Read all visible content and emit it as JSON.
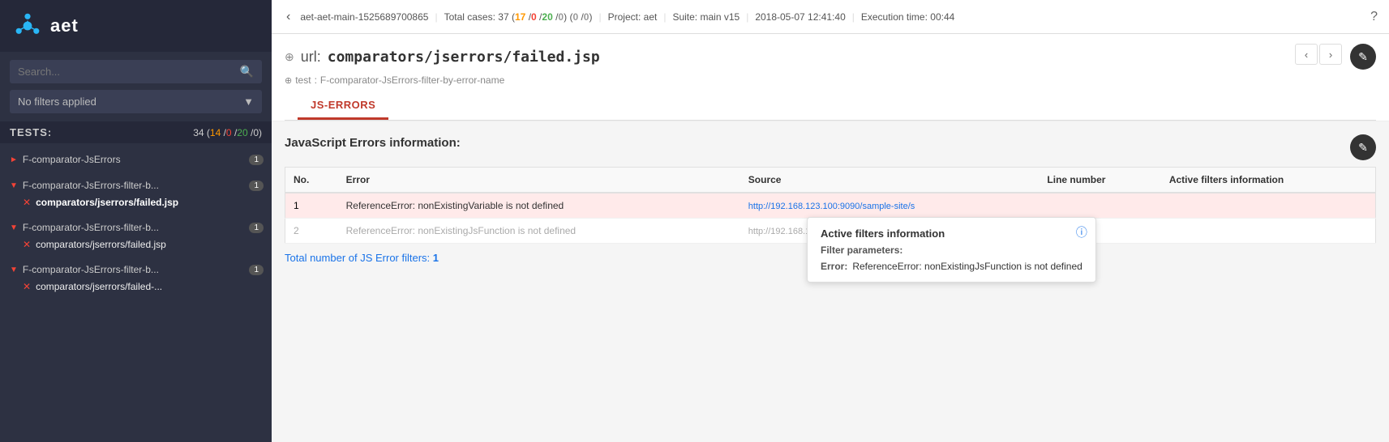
{
  "sidebar": {
    "logo_text": "aet",
    "search_placeholder": "Search...",
    "filter_label": "No filters applied",
    "tests_label": "TESTS:",
    "tests_count": "34",
    "counts": {
      "pass": "14",
      "fail": "0",
      "warn": "20",
      "other": "0"
    },
    "groups": [
      {
        "id": "g1",
        "name": "F-comparator-JsErrors",
        "badge": "1",
        "expanded": false,
        "arrow": "▶",
        "items": []
      },
      {
        "id": "g2",
        "name": "F-comparator-JsErrors-filter-b...",
        "badge": "1",
        "expanded": true,
        "arrow": "▼",
        "items": [
          {
            "name": "comparators/jserrors/failed.jsp",
            "active": true
          }
        ]
      },
      {
        "id": "g3",
        "name": "F-comparator-JsErrors-filter-b...",
        "badge": "1",
        "expanded": true,
        "arrow": "▼",
        "items": [
          {
            "name": "comparators/jserrors/failed.jsp",
            "active": false
          }
        ]
      },
      {
        "id": "g4",
        "name": "F-comparator-JsErrors-filter-b...",
        "badge": "1",
        "expanded": true,
        "arrow": "▼",
        "items": [
          {
            "name": "comparators/jserrors/failed-...",
            "active": false
          }
        ]
      }
    ]
  },
  "topbar": {
    "back_label": "‹",
    "run_name": "aet-aet-main-1525689700865",
    "total_cases_label": "Total cases:",
    "total": "37",
    "count_orange": "17",
    "count_red": "0",
    "count_green": "20",
    "count_gray1": "0",
    "count_gray2": "0",
    "count_gray3": "0",
    "project_label": "Project:",
    "project": "aet",
    "suite_label": "Suite:",
    "suite": "main v15",
    "date": "2018-05-07 12:41:40",
    "exec_label": "Execution time:",
    "exec_time": "00:44",
    "help_icon": "?"
  },
  "url_section": {
    "icon": "⊕",
    "url_label": "url:",
    "url_path": "comparators/jserrors/failed.jsp",
    "test_icon": "⊕",
    "test_label": "test",
    "test_name": "F-comparator-JsErrors-filter-by-error-name"
  },
  "tabs": [
    {
      "id": "js-errors",
      "label": "JS-ERRORS",
      "active": true
    }
  ],
  "table": {
    "section_title": "JavaScript Errors information:",
    "columns": [
      "No.",
      "Error",
      "Source",
      "Line number",
      "Active filters information"
    ],
    "rows": [
      {
        "no": "1",
        "error": "ReferenceError: nonExistingVariable is not defined",
        "source": "http://192.168.123.100:9090/sample-site/s",
        "line_number": "",
        "active_filters": "",
        "style": "error"
      },
      {
        "no": "2",
        "error": "ReferenceError: nonExistingJsFunction is not defined",
        "source": "http://192.168.123.100:9090/sample-site/s",
        "line_number": "",
        "active_filters": "",
        "style": "filtered"
      }
    ],
    "total_label": "Total number of JS Error filters:",
    "total_count": "1"
  },
  "tooltip": {
    "title": "Active filters information",
    "section_label": "Filter parameters:",
    "error_key": "Error:",
    "error_value": "ReferenceError: nonExistingJsFunction is not defined"
  },
  "icons": {
    "prev_nav": "‹",
    "next_nav": "›",
    "comment": "✎",
    "info": "ℹ"
  }
}
